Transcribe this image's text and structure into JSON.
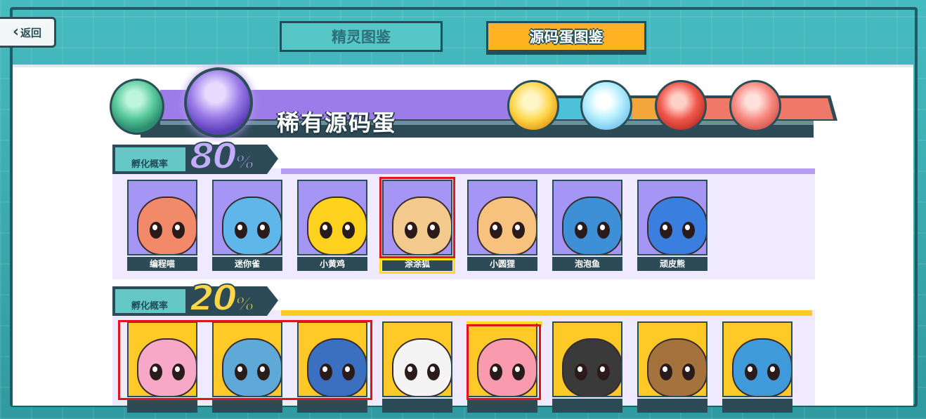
{
  "header": {
    "back_label": "返回",
    "tabs": [
      {
        "label": "精灵图鉴",
        "active": false
      },
      {
        "label": "源码蛋图鉴",
        "active": true
      }
    ]
  },
  "banner": {
    "title": "稀有源码蛋",
    "eggs": [
      "green-egg-icon",
      "purple-egg-icon",
      "gold-blue-egg-icon",
      "rainbow-egg-icon",
      "red-gold-egg-icon",
      "special-red-egg-icon"
    ]
  },
  "sections": [
    {
      "rate_label": "孵化概率",
      "rate_value": "80",
      "rate_unit": "%",
      "accent": "#b79af2",
      "spirits": [
        {
          "name": "编程喵",
          "color": "#f28a6a"
        },
        {
          "name": "迷你雀",
          "color": "#5fb6ea"
        },
        {
          "name": "小黄鸡",
          "color": "#ffd21f"
        },
        {
          "name": "涂涂狐",
          "color": "#f3c98e"
        },
        {
          "name": "小圆狸",
          "color": "#f7c27d"
        },
        {
          "name": "泡泡鱼",
          "color": "#3d8fd6"
        },
        {
          "name": "顽皮熊",
          "color": "#3a7fe0"
        }
      ]
    },
    {
      "rate_label": "孵化概率",
      "rate_value": "20",
      "rate_unit": "%",
      "accent": "#ffc928",
      "spirits": [
        {
          "name": "",
          "color": "#f7a8c6"
        },
        {
          "name": "",
          "color": "#5ea9d8"
        },
        {
          "name": "",
          "color": "#3b6fbf"
        },
        {
          "name": "",
          "color": "#f4f4f4"
        },
        {
          "name": "",
          "color": "#f99aae"
        },
        {
          "name": "",
          "color": "#3a3a3a"
        },
        {
          "name": "",
          "color": "#a3723d"
        },
        {
          "name": "",
          "color": "#3f9ad9"
        }
      ]
    }
  ]
}
